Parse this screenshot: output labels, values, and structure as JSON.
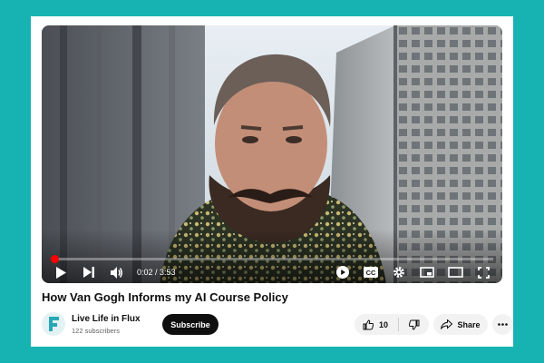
{
  "video": {
    "current_time": "0:02",
    "duration": "3:53",
    "time_display": "0:02 / 3:53",
    "progress": 0.009
  },
  "title": "How Van Gogh Informs my AI Course Policy",
  "channel": {
    "name": "Live Life in Flux",
    "subscribers": "122 subscribers",
    "avatar_letter": "F"
  },
  "actions": {
    "subscribe_label": "Subscribe",
    "like_count": "10",
    "share_label": "Share"
  },
  "icons": {
    "play": "play-icon",
    "next": "next-icon",
    "volume": "volume-icon",
    "autoplay": "autoplay-icon",
    "captions": "cc-icon",
    "settings": "gear-icon",
    "miniplayer": "miniplayer-icon",
    "theater": "theater-icon",
    "fullscreen": "fullscreen-icon",
    "like": "thumbs-up-icon",
    "dislike": "thumbs-down-icon",
    "share": "share-icon",
    "more": "more-icon"
  },
  "colors": {
    "page_background": "#17b3b3",
    "progress": "#ff0000",
    "subscribe_bg": "#0f0f0f",
    "pill_bg": "#f2f2f2",
    "avatar_accent": "#2aa7b5"
  }
}
